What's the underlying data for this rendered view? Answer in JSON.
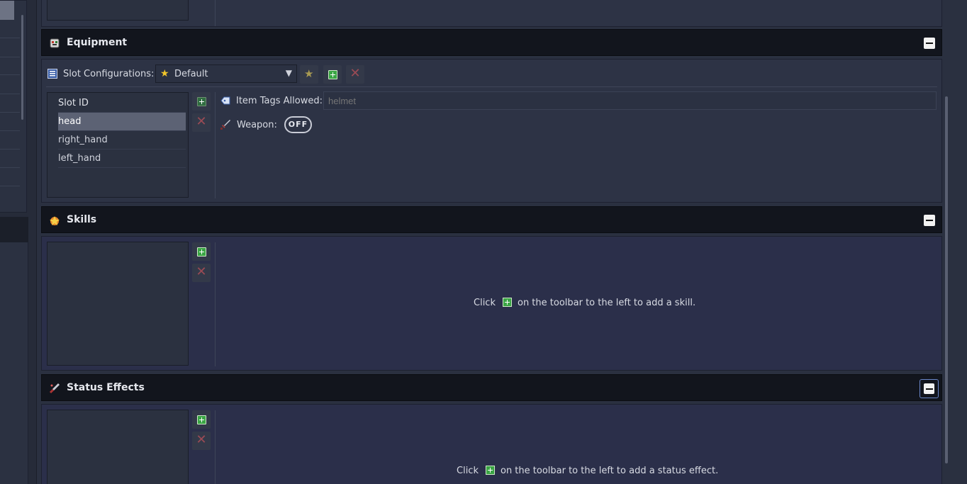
{
  "equipment": {
    "title": "Equipment",
    "slot_config_label": "Slot Configurations:",
    "slot_config_value": "Default",
    "slots": [
      "Slot ID",
      "head",
      "right_hand",
      "left_hand"
    ],
    "item_tags_label": "Item Tags Allowed:",
    "item_tags_placeholder": "helmet",
    "weapon_label": "Weapon:",
    "weapon_toggle": "OFF"
  },
  "skills": {
    "title": "Skills",
    "hint_before": "Click",
    "hint_after": "on the toolbar to the left to add a skill."
  },
  "status_effects": {
    "title": "Status Effects",
    "hint_before": "Click",
    "hint_after": "on the toolbar to the left to add a status effect."
  },
  "colors": {
    "accent_green": "#3aa544",
    "delete_red": "#9b4b55",
    "star_yellow": "#f2c62a"
  }
}
